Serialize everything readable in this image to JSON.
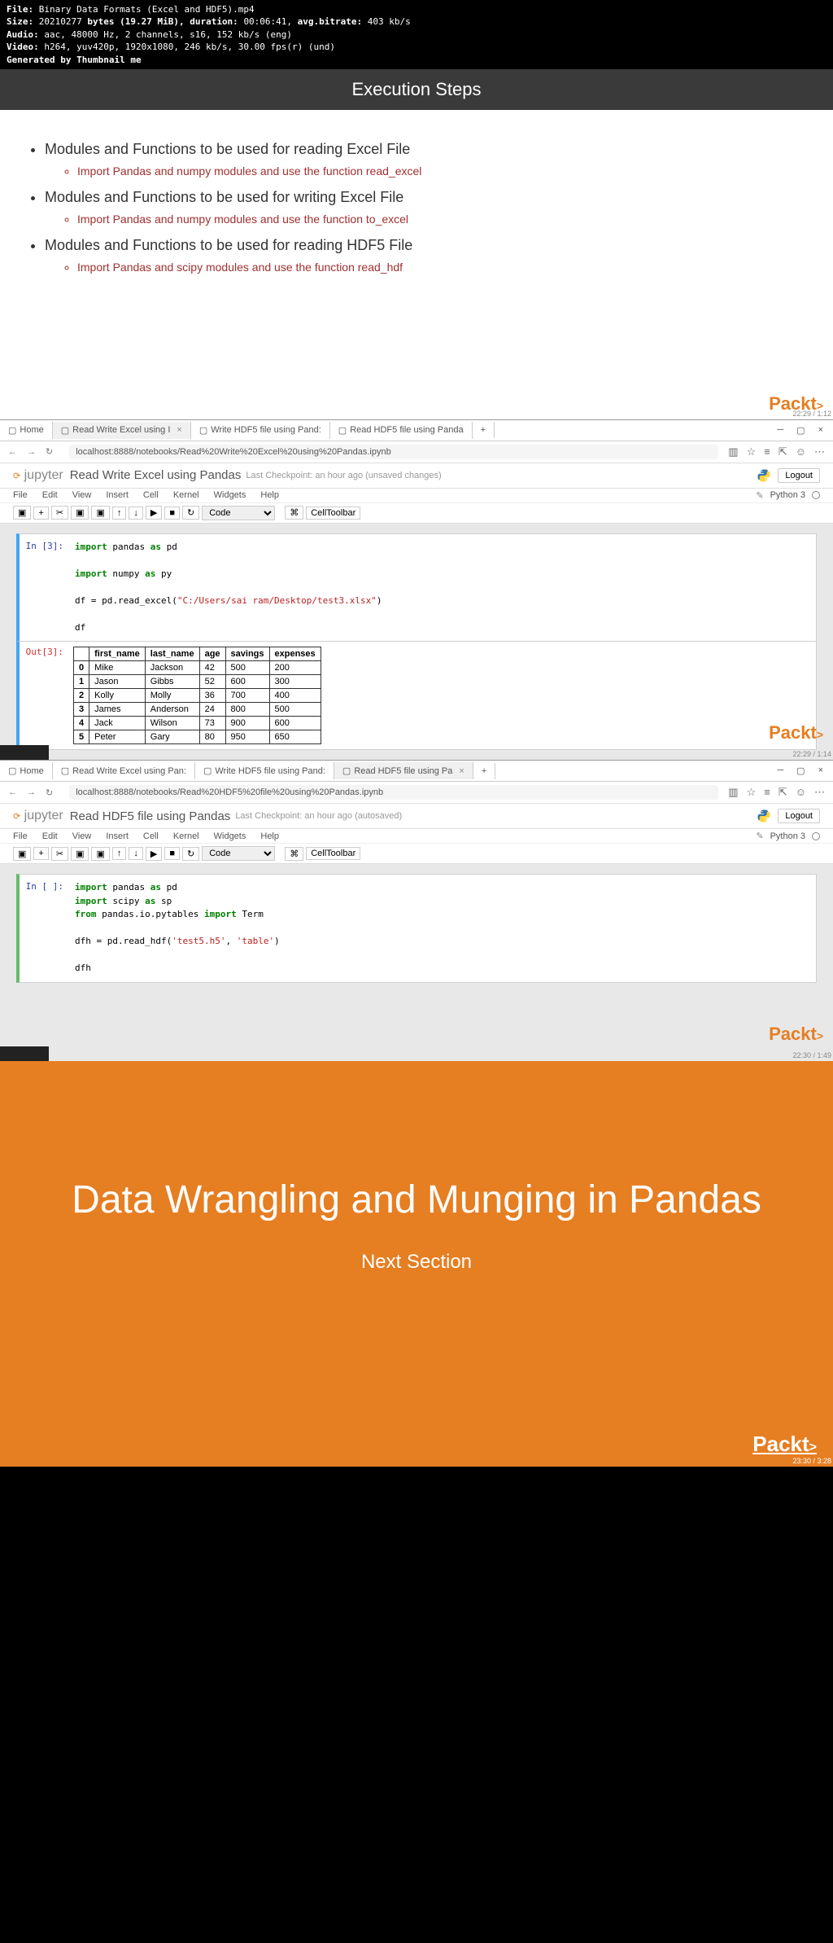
{
  "metadata": {
    "file_label": "File:",
    "file": "Binary Data Formats (Excel and HDF5).mp4",
    "size_label": "Size:",
    "size_bytes": "20210277",
    "size_mib": "bytes (19.27 MiB),",
    "duration_label": "duration:",
    "duration": "00:06:41,",
    "bitrate_label": "avg.bitrate:",
    "bitrate": "403 kb/s",
    "audio_label": "Audio:",
    "audio": "aac, 48000 Hz, 2 channels, s16, 152 kb/s (eng)",
    "video_label": "Video:",
    "video": "h264, yuv420p, 1920x1080, 246 kb/s, 30.00 fps(r) (und)",
    "gen_label": "Generated by Thumbnail me"
  },
  "slide1": {
    "title": "Execution Steps",
    "b1": "Modules and Functions to be used for reading Excel File",
    "s1": "Import Pandas and numpy modules and use the function read_excel",
    "b2": "Modules and Functions to be used for writing Excel File",
    "s2": "Import Pandas and numpy modules and use the function to_excel",
    "b3": "Modules and Functions to be used for reading HDF5 File",
    "s3": "Import Pandas and scipy modules and use the function read_hdf",
    "logo": "Packt",
    "ts": "22:29 / 1:12"
  },
  "tabs": {
    "home": "Home",
    "t1": "Read Write Excel using I",
    "t2": "Write HDF5 file using Pand:",
    "t3": "Read HDF5 file using Panda",
    "t1b": "Read Write Excel using Pan:",
    "t3b": "Read HDF5 file using Pa",
    "plus": "+"
  },
  "addr": {
    "url1": "localhost:8888/notebooks/Read%20Write%20Excel%20using%20Pandas.ipynb",
    "url2": "localhost:8888/notebooks/Read%20HDF5%20file%20using%20Pandas.ipynb"
  },
  "jup": {
    "logo": "jupyter",
    "title1": "Read Write Excel using Pandas",
    "title2": "Read HDF5 file using Pandas",
    "checkpoint1": "Last Checkpoint: an hour ago (unsaved changes)",
    "checkpoint2": "Last Checkpoint: an hour ago (autosaved)",
    "logout": "Logout",
    "kernel": "Python 3",
    "menu": [
      "File",
      "Edit",
      "View",
      "Insert",
      "Cell",
      "Kernel",
      "Widgets",
      "Help"
    ],
    "celltype": "Code",
    "celltoolbar": "CellToolbar"
  },
  "cell1": {
    "prompt": "In [3]:",
    "l1a": "import",
    "l1b": " pandas ",
    "l1c": "as",
    "l1d": " pd",
    "l2a": "import",
    "l2b": " numpy ",
    "l2c": "as",
    "l2d": " py",
    "l3a": "df = pd.read_excel(",
    "l3b": "\"C:/Users/sai ram/Desktop/test3.xlsx\"",
    "l3c": ")",
    "l4": "df"
  },
  "out1": {
    "prompt": "Out[3]:",
    "cols": [
      "",
      "first_name",
      "last_name",
      "age",
      "savings",
      "expenses"
    ],
    "rows": [
      [
        "0",
        "Mike",
        "Jackson",
        "42",
        "500",
        "200"
      ],
      [
        "1",
        "Jason",
        "Gibbs",
        "52",
        "600",
        "300"
      ],
      [
        "2",
        "Kolly",
        "Molly",
        "36",
        "700",
        "400"
      ],
      [
        "3",
        "James",
        "Anderson",
        "24",
        "800",
        "500"
      ],
      [
        "4",
        "Jack",
        "Wilson",
        "73",
        "900",
        "600"
      ],
      [
        "5",
        "Peter",
        "Gary",
        "80",
        "950",
        "650"
      ]
    ]
  },
  "cell2": {
    "prompt": "In [ ]:",
    "l1": "import pandas as pd",
    "l2": "import scipy as sp",
    "l3a": "from",
    "l3b": " pandas.io.pytables ",
    "l3c": "import",
    "l3d": " Term",
    "l4a": "dfh = pd.read_hdf(",
    "l4b": "'test5.h5'",
    "l4c": ", ",
    "l4d": "'table'",
    "l4e": ")",
    "l5": "dfh"
  },
  "ts2": "22:29 / 1:14",
  "ts3": "22:30 / 1:49",
  "ts4": "23:30 / 3:28",
  "orange": {
    "title": "Data Wrangling and Munging in Pandas",
    "sub": "Next Section",
    "logo": "Packt"
  }
}
